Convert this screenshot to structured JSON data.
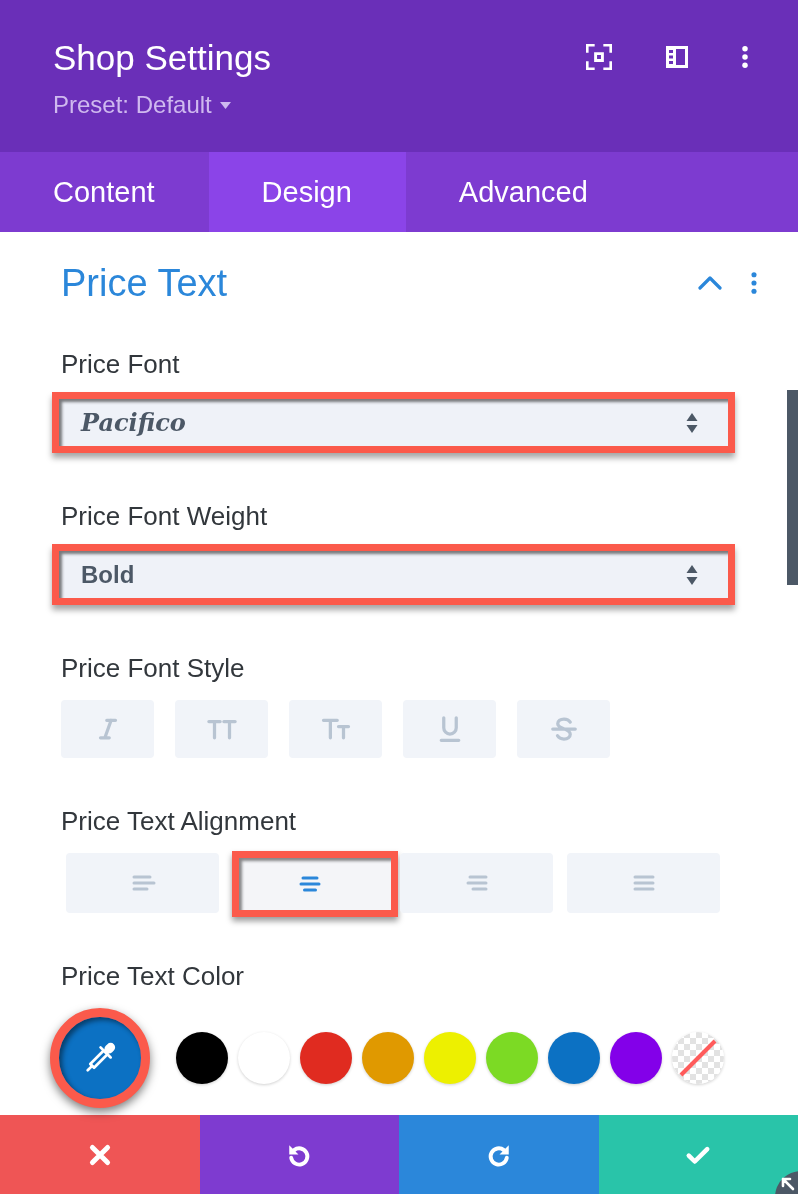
{
  "header": {
    "title": "Shop Settings",
    "preset": "Preset: Default"
  },
  "tabs": [
    {
      "label": "Content",
      "selected": false
    },
    {
      "label": "Design",
      "selected": true
    },
    {
      "label": "Advanced",
      "selected": false
    }
  ],
  "section": {
    "title": "Price Text",
    "expanded": true
  },
  "fields": [
    {
      "kind": "font_select",
      "label": "Price Font",
      "value": "Pacifico",
      "highlighted": true
    },
    {
      "kind": "select",
      "label": "Price Font Weight",
      "value": "Bold",
      "highlighted": true
    },
    {
      "kind": "toggles",
      "label": "Price Font Style",
      "options": [
        {
          "kind": "italic",
          "on": false
        },
        {
          "kind": "uppercase",
          "on": false
        },
        {
          "kind": "smallcaps",
          "on": false
        },
        {
          "kind": "underline",
          "on": false
        },
        {
          "kind": "strikethrough",
          "on": false
        }
      ]
    },
    {
      "kind": "alignment",
      "label": "Price Text Alignment",
      "options": [
        {
          "kind": "left",
          "selected": false,
          "highlighted": false
        },
        {
          "kind": "center",
          "selected": true,
          "highlighted": true
        },
        {
          "kind": "right",
          "selected": false,
          "highlighted": false
        },
        {
          "kind": "justify",
          "selected": false,
          "highlighted": false
        }
      ]
    },
    {
      "kind": "color",
      "label": "Price Text Color",
      "picker": {
        "color": "#0c71c3",
        "highlighted": true
      },
      "swatches": [
        {
          "kind": "color",
          "color": "#000000"
        },
        {
          "kind": "color",
          "color": "#ffffff"
        },
        {
          "kind": "color",
          "color": "#e02b20"
        },
        {
          "kind": "color",
          "color": "#e09900"
        },
        {
          "kind": "color",
          "color": "#edf000"
        },
        {
          "kind": "color",
          "color": "#7cda24"
        },
        {
          "kind": "color",
          "color": "#0c71c3"
        },
        {
          "kind": "color",
          "color": "#8300e9"
        },
        {
          "kind": "transparent"
        }
      ]
    }
  ],
  "footer": {
    "buttons": [
      {
        "kind": "discard"
      },
      {
        "kind": "undo"
      },
      {
        "kind": "redo"
      },
      {
        "kind": "save"
      }
    ]
  }
}
